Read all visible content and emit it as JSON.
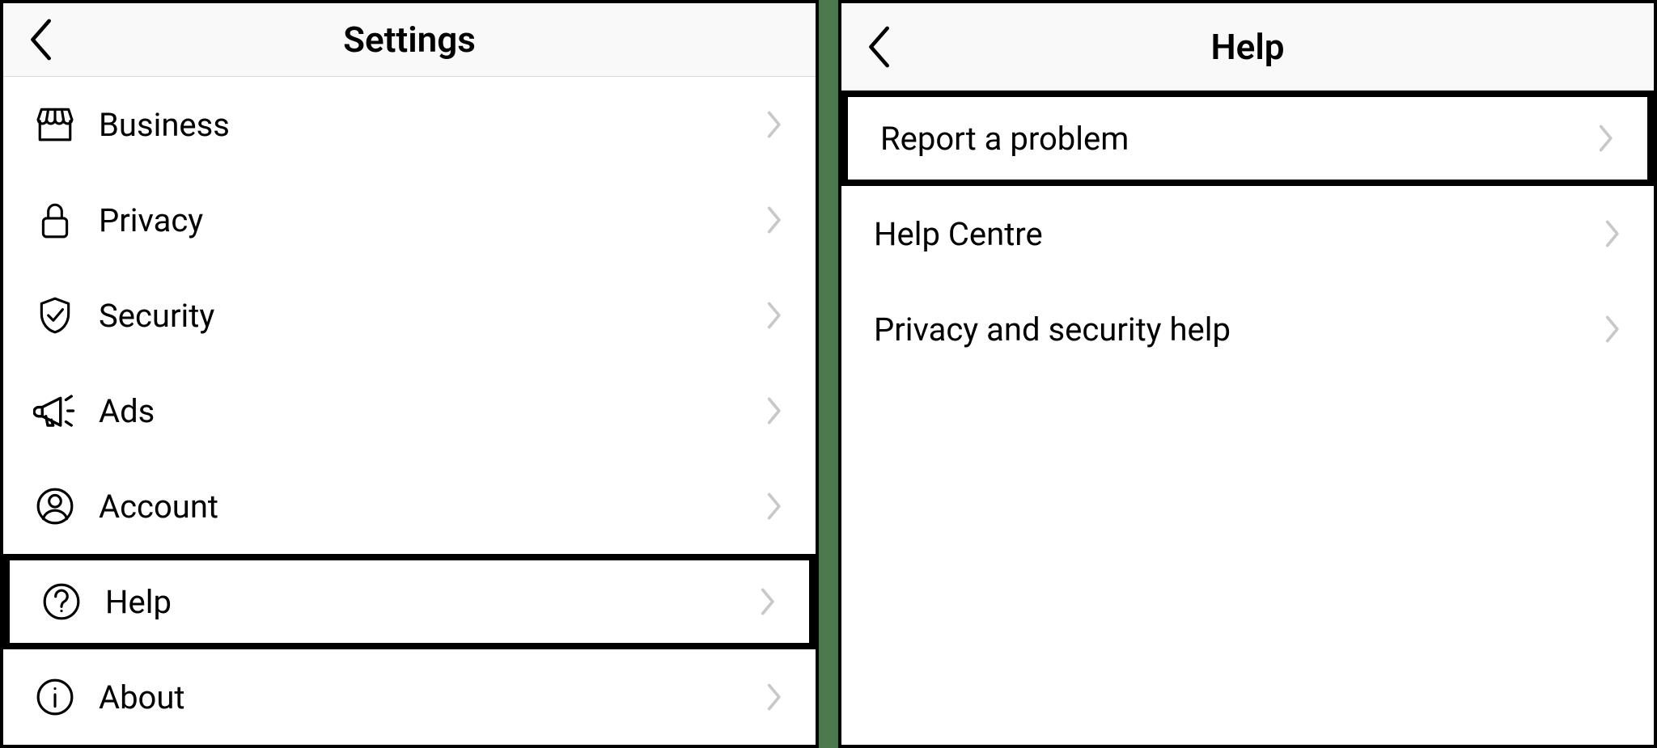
{
  "settings_panel": {
    "title": "Settings",
    "items": [
      {
        "label": "Business",
        "icon": "storefront",
        "highlight": false
      },
      {
        "label": "Privacy",
        "icon": "lock",
        "highlight": false
      },
      {
        "label": "Security",
        "icon": "shield",
        "highlight": false
      },
      {
        "label": "Ads",
        "icon": "megaphone",
        "highlight": false
      },
      {
        "label": "Account",
        "icon": "user-circle",
        "highlight": false
      },
      {
        "label": "Help",
        "icon": "question",
        "highlight": true
      },
      {
        "label": "About",
        "icon": "info",
        "highlight": false
      }
    ]
  },
  "help_panel": {
    "title": "Help",
    "items": [
      {
        "label": "Report a problem",
        "highlight": true
      },
      {
        "label": "Help Centre",
        "highlight": false
      },
      {
        "label": "Privacy and security help",
        "highlight": false
      }
    ]
  }
}
